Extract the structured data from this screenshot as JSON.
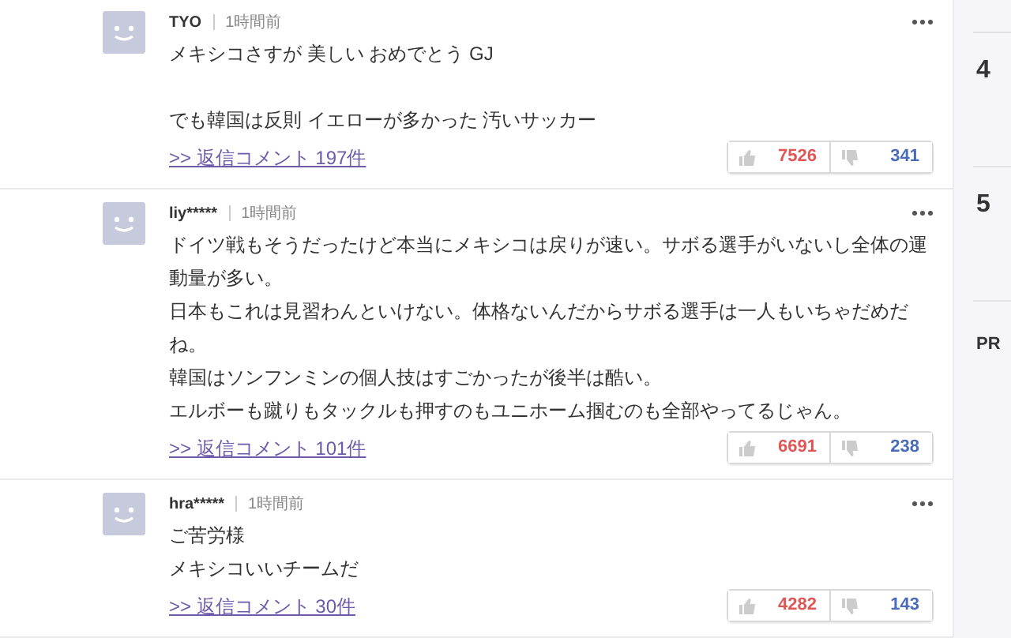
{
  "comments": [
    {
      "user": "TYO",
      "time": "1時間前",
      "paragraphs": [
        [
          "メキシコさすが 美しい おめでとう GJ"
        ],
        [
          "でも韓国は反則 イエローが多かった 汚いサッカー"
        ]
      ],
      "replies": ">> 返信コメント 197件",
      "likes": "7526",
      "dislikes": "341"
    },
    {
      "user": "liy*****",
      "time": "1時間前",
      "paragraphs": [
        [
          "ドイツ戦もそうだったけど本当にメキシコは戻りが速い。サボる選手がいないし全体の運",
          "動量が多い。",
          "日本もこれは見習わんといけない。体格ないんだからサボる選手は一人もいちゃだめだ",
          "ね。",
          "韓国はソンフンミンの個人技はすごかったが後半は酷い。",
          "エルボーも蹴りもタックルも押すのもユニホーム掴むのも全部やってるじゃん。"
        ]
      ],
      "replies": ">> 返信コメント 101件",
      "likes": "6691",
      "dislikes": "238"
    },
    {
      "user": "hra*****",
      "time": "1時間前",
      "paragraphs": [
        [
          "ご苦労様",
          "メキシコいいチームだ"
        ]
      ],
      "replies": ">> 返信コメント 30件",
      "likes": "4282",
      "dislikes": "143"
    }
  ],
  "sidebar": {
    "items": [
      {
        "kind": "rank",
        "label": "4"
      },
      {
        "kind": "rank",
        "label": "5"
      },
      {
        "kind": "pr",
        "label": "PR"
      }
    ]
  }
}
